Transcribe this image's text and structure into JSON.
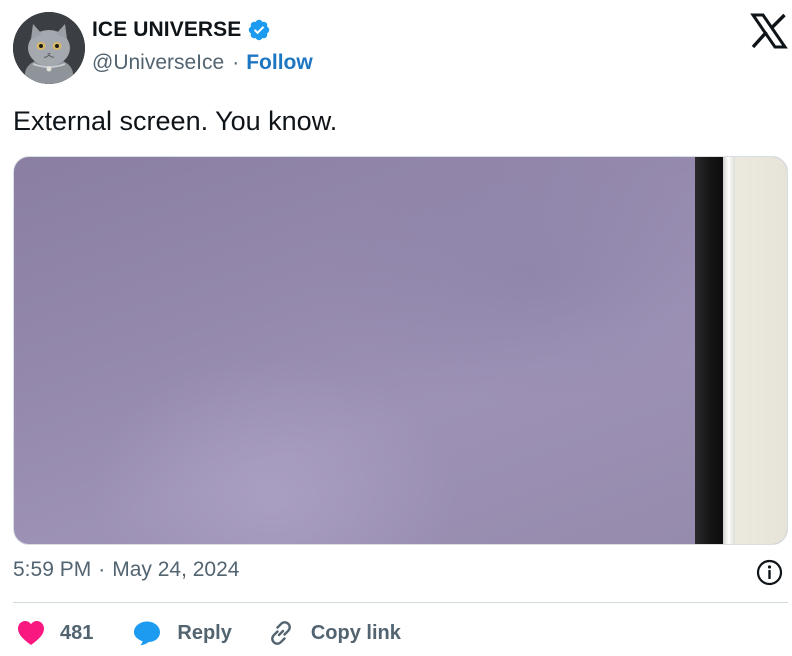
{
  "author": {
    "display_name": "ICE UNIVERSE",
    "handle": "@UniverseIce",
    "separator": "·",
    "follow_label": "Follow",
    "verified": true
  },
  "tweet": {
    "text": "External screen. You know."
  },
  "meta": {
    "time": "5:59 PM",
    "separator": "·",
    "date": "May 24, 2024"
  },
  "actions": {
    "likes_count": "481",
    "reply_label": "Reply",
    "copy_link_label": "Copy link"
  },
  "colors": {
    "link_blue": "#1d76c2",
    "verified_blue": "#1d9bf0",
    "like_pink": "#f91880",
    "secondary_text": "#536471"
  },
  "icons": [
    "avatar-cat",
    "verified-badge-icon",
    "x-logo-icon",
    "info-icon",
    "heart-icon",
    "reply-bubble-icon",
    "link-icon"
  ]
}
